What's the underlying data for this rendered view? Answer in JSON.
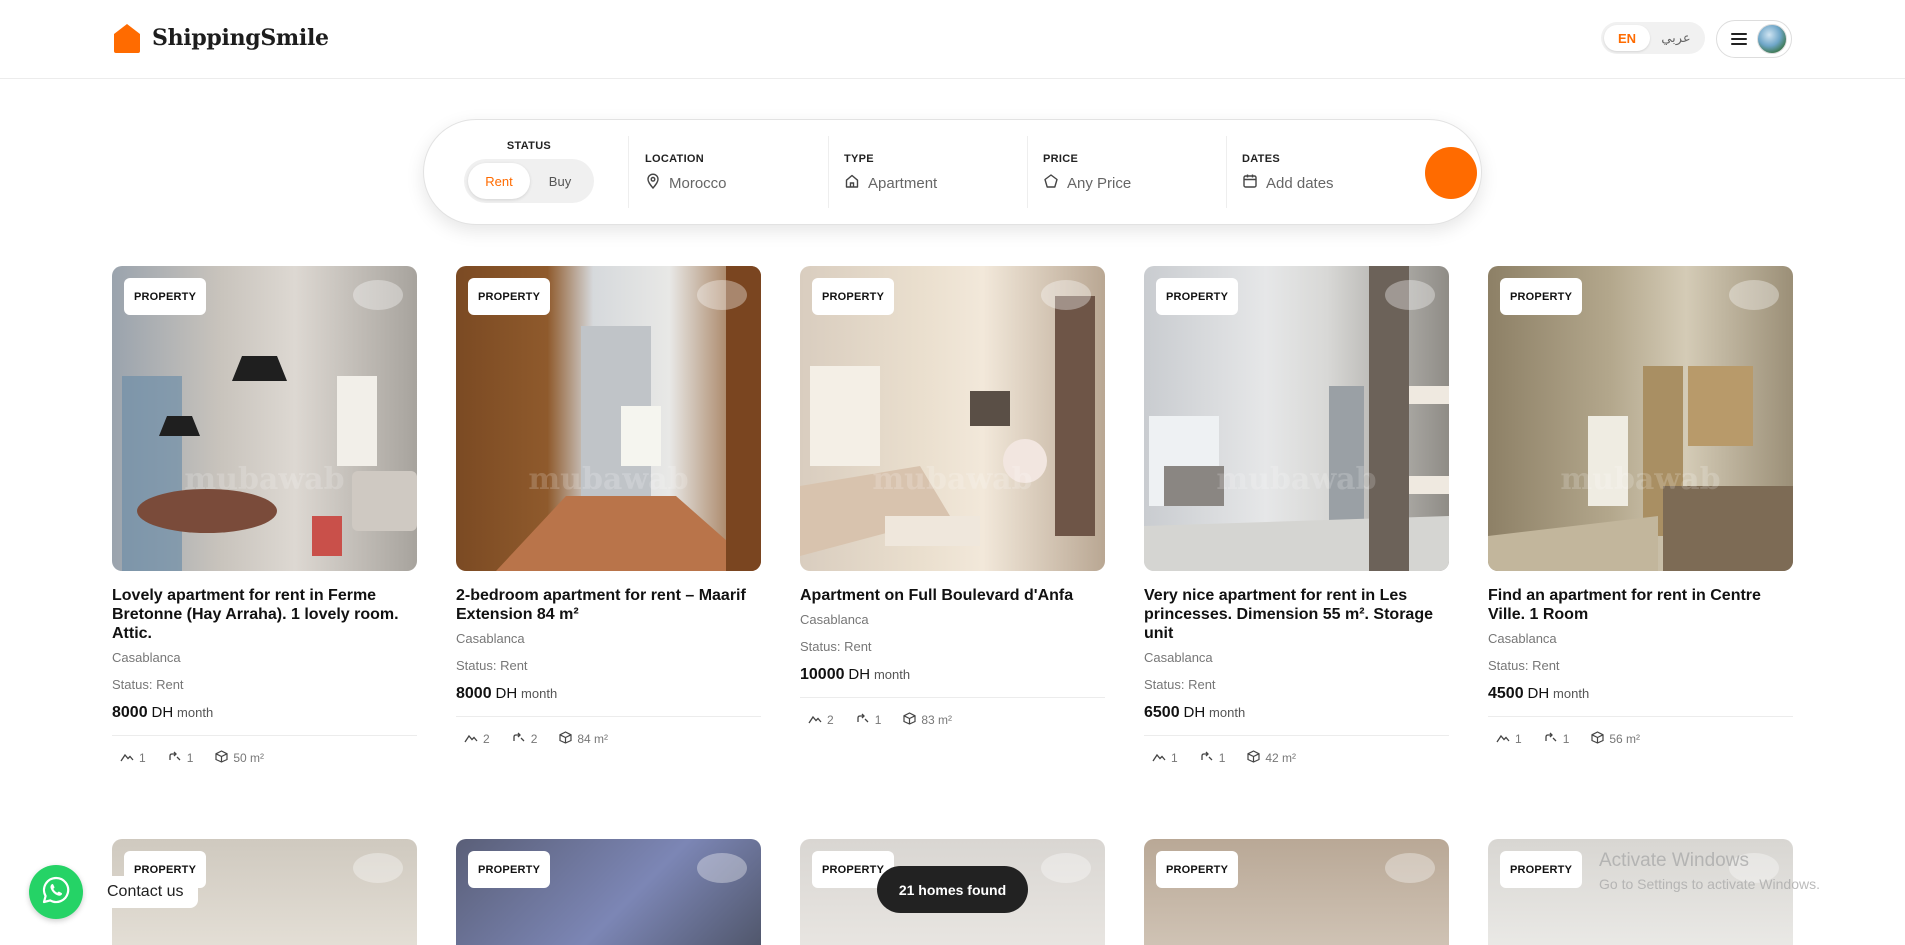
{
  "brand": {
    "name": "ShippingSmile",
    "color": "#ff6b00"
  },
  "language": {
    "en": "EN",
    "ar": "عربي"
  },
  "search": {
    "status_label": "STATUS",
    "rent": "Rent",
    "buy": "Buy",
    "location_label": "LOCATION",
    "location_value": "Morocco",
    "type_label": "TYPE",
    "type_value": "Apartment",
    "price_label": "PRICE",
    "price_value": "Any Price",
    "dates_label": "DATES",
    "dates_value": "Add dates"
  },
  "listings": [
    {
      "badge": "PROPERTY",
      "title": "Lovely apartment for rent in Ferme Bretonne (Hay Arraha). 1 lovely room. Attic.",
      "city": "Casablanca",
      "status": "Status: Rent",
      "price": "8000",
      "currency": "DH",
      "period": "month",
      "rooms": "1",
      "baths": "1",
      "area": "50 m²"
    },
    {
      "badge": "PROPERTY",
      "title": "2-bedroom apartment for rent – Maarif Extension 84 m²",
      "city": "Casablanca",
      "status": "Status: Rent",
      "price": "8000",
      "currency": "DH",
      "period": "month",
      "rooms": "2",
      "baths": "2",
      "area": "84 m²"
    },
    {
      "badge": "PROPERTY",
      "title": "Apartment on Full Boulevard d'Anfa",
      "city": "Casablanca",
      "status": "Status: Rent",
      "price": "10000",
      "currency": "DH",
      "period": "month",
      "rooms": "2",
      "baths": "1",
      "area": "83 m²"
    },
    {
      "badge": "PROPERTY",
      "title": "Very nice apartment for rent in Les princesses. Dimension 55 m². Storage unit",
      "city": "Casablanca",
      "status": "Status: Rent",
      "price": "6500",
      "currency": "DH",
      "period": "month",
      "rooms": "1",
      "baths": "1",
      "area": "42 m²"
    },
    {
      "badge": "PROPERTY",
      "title": "Find an apartment for rent in Centre Ville. 1 Room",
      "city": "Casablanca",
      "status": "Status: Rent",
      "price": "4500",
      "currency": "DH",
      "period": "month",
      "rooms": "1",
      "baths": "1",
      "area": "56 m²"
    }
  ],
  "listings_row2": [
    {
      "badge": "PROPERTY"
    },
    {
      "badge": "PROPERTY"
    },
    {
      "badge": "PROPERTY"
    },
    {
      "badge": "PROPERTY"
    },
    {
      "badge": "PROPERTY"
    }
  ],
  "results_count": "21 homes found",
  "contact": {
    "label": "Contact us"
  },
  "os_watermark": {
    "line1": "Activate Windows",
    "line2": "Go to Settings to activate Windows."
  }
}
